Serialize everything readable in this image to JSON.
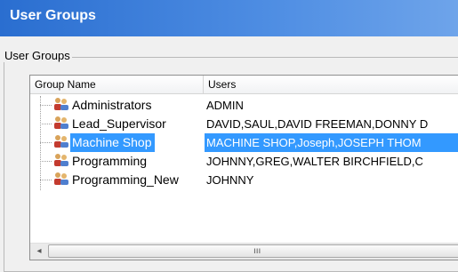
{
  "window": {
    "title": "User Groups"
  },
  "groupbox": {
    "label": "User Groups"
  },
  "tree": {
    "columns": [
      "Group Name",
      "Users"
    ],
    "rows": [
      {
        "name": "Administrators",
        "users": "ADMIN",
        "selected": false
      },
      {
        "name": "Lead_Supervisor",
        "users": "DAVID,SAUL,DAVID FREEMAN,DONNY D",
        "selected": false
      },
      {
        "name": "Machine Shop",
        "users": "MACHINE SHOP,Joseph,JOSEPH THOM",
        "selected": true
      },
      {
        "name": "Programming",
        "users": "JOHNNY,GREG,WALTER BIRCHFIELD,C",
        "selected": false
      },
      {
        "name": "Programming_New",
        "users": "JOHNNY",
        "selected": false
      }
    ],
    "group_icon": "user-group-icon"
  },
  "scrollbar": {
    "left_arrow": "◂",
    "grip": "ııı"
  },
  "colors": {
    "title_bar": "#2a6ed0",
    "selection": "#3399ff"
  }
}
